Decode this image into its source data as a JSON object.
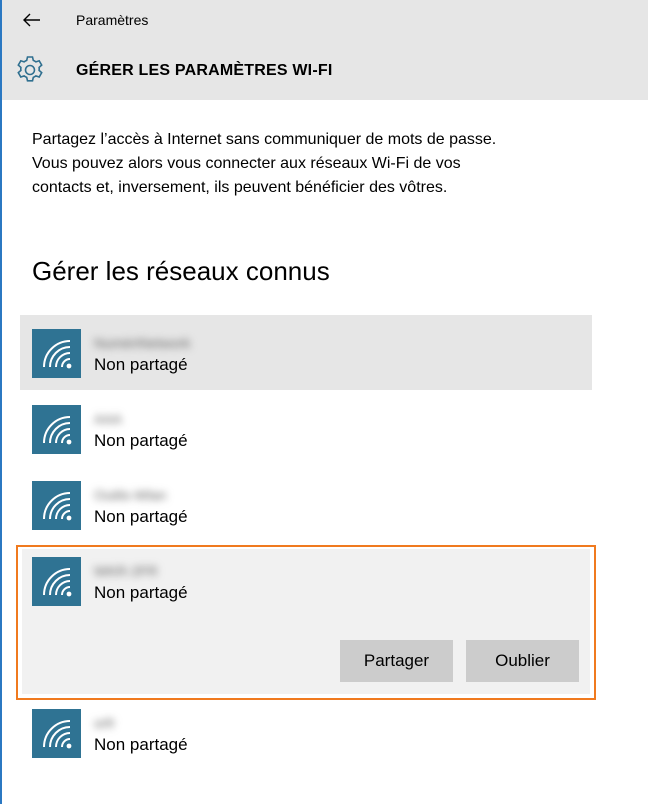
{
  "app": {
    "title": "Paramètres"
  },
  "header": {
    "title": "GÉRER LES PARAMÈTRES WI-FI"
  },
  "intro": {
    "line1": "Partagez l’accès à Internet sans communiquer de mots de passe.",
    "line2": "Vous pouvez alors vous connecter aux réseaux Wi-Fi de vos",
    "line3": "contacts et, inversement, ils peuvent bénéficier des vôtres."
  },
  "section": {
    "title": "Gérer les réseaux connus"
  },
  "networks": [
    {
      "name": "NumériNetwork",
      "status": "Non partagé"
    },
    {
      "name": "AAA",
      "status": "Non partagé"
    },
    {
      "name": "Outils-Wlan",
      "status": "Non partagé"
    },
    {
      "name": "WKR-2FR",
      "status": "Non partagé"
    },
    {
      "name": "orfr",
      "status": "Non partagé"
    }
  ],
  "actions": {
    "share_label": "Partager",
    "forget_label": "Oublier"
  },
  "colors": {
    "tile": "#2f7393",
    "selection": "#f07a1f",
    "header_bg": "#e6e6e6",
    "button_bg": "#cccccc"
  },
  "icons": {
    "back": "back-arrow-icon",
    "settings": "gear-icon",
    "network": "wifi-icon"
  }
}
